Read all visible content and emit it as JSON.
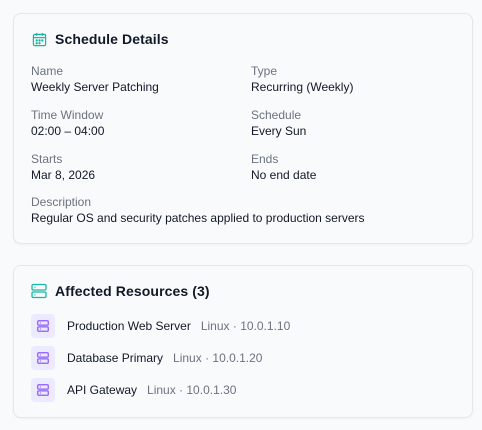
{
  "schedule": {
    "title": "Schedule Details",
    "fields": {
      "name": {
        "label": "Name",
        "value": "Weekly Server Patching"
      },
      "type": {
        "label": "Type",
        "value": "Recurring (Weekly)"
      },
      "time_window": {
        "label": "Time Window",
        "value": "02:00 – 04:00"
      },
      "schedule": {
        "label": "Schedule",
        "value": "Every Sun"
      },
      "starts": {
        "label": "Starts",
        "value": "Mar 8, 2026"
      },
      "ends": {
        "label": "Ends",
        "value": "No end date"
      },
      "description": {
        "label": "Description",
        "value": "Regular OS and security patches applied to production servers"
      }
    }
  },
  "resources": {
    "title": "Affected Resources (3)",
    "items": [
      {
        "name": "Production Web Server",
        "meta": "Linux · 10.0.1.10"
      },
      {
        "name": "Database Primary",
        "meta": "Linux · 10.0.1.20"
      },
      {
        "name": "API Gateway",
        "meta": "Linux · 10.0.1.30"
      }
    ]
  },
  "colors": {
    "accent": "#14b8a6",
    "resource_icon_bg": "#ede9fe",
    "resource_icon": "#8b5cf6"
  },
  "icons": {
    "schedule": "calendar-icon",
    "resources": "server-icon",
    "resource_item": "server-icon"
  }
}
